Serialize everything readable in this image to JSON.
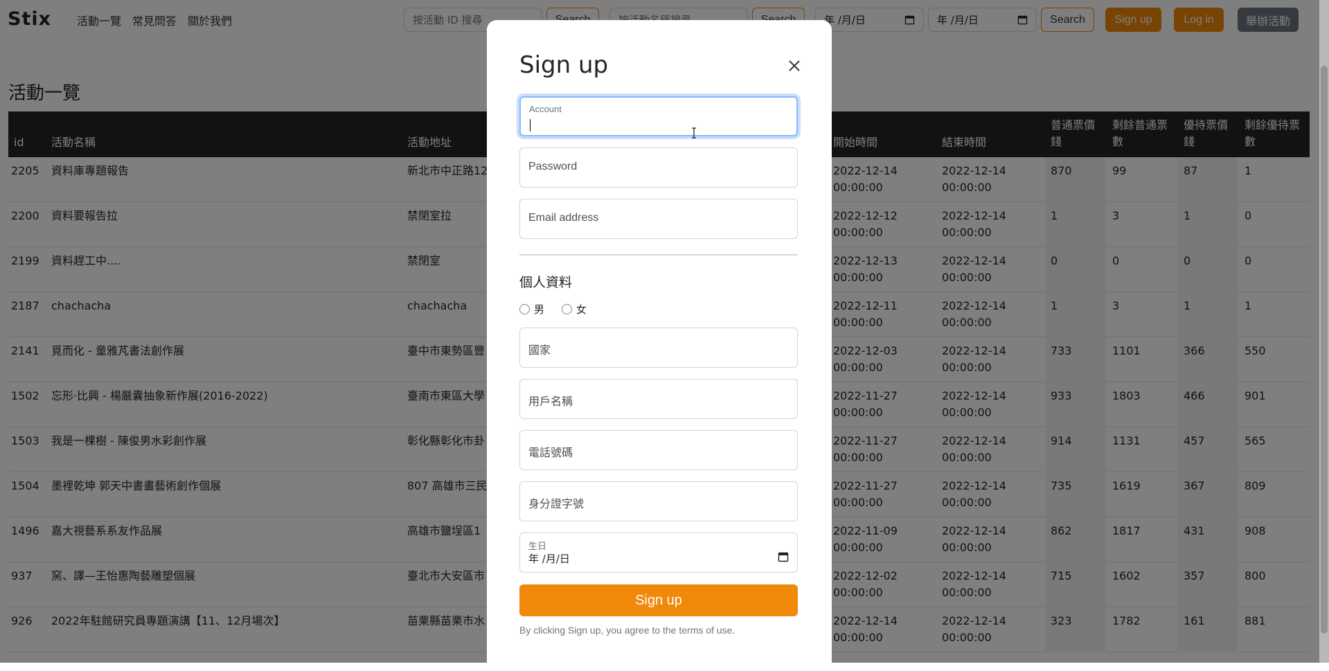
{
  "navbar": {
    "brand": "Stix",
    "links": [
      "活動一覽",
      "常見問答",
      "關於我們"
    ],
    "search_id_placeholder": "按活動 ID 搜尋",
    "search_id_button": "Search",
    "search_name_placeholder": "按活動名稱搜尋",
    "search_name_button": "Search",
    "date_start": "年 /月/日",
    "date_end": "年 /月/日",
    "date_search_button": "Search",
    "signup_button": "Sign up",
    "login_button": "Log in",
    "host_button": "舉辦活動"
  },
  "page": {
    "title": "活動一覽",
    "columns": [
      "id",
      "活動名稱",
      "活動地址",
      "開始時間",
      "結束時間",
      "普通票價錢",
      "剩餘普通票數",
      "優待票價錢",
      "剩餘優待票數"
    ],
    "rows": [
      {
        "id": "2205",
        "name": "資料庫專題報告",
        "addr": "新北市中正路12",
        "start": "2022-12-14 00:00:00",
        "end": "2022-12-14 00:00:00",
        "p1": "870",
        "r1": "99",
        "p2": "87",
        "r2": "1"
      },
      {
        "id": "2200",
        "name": "資料要報告拉",
        "addr": "禁閉室拉",
        "start": "2022-12-12 00:00:00",
        "end": "2022-12-14 00:00:00",
        "p1": "1",
        "r1": "3",
        "p2": "1",
        "r2": "0"
      },
      {
        "id": "2199",
        "name": "資料趕工中....",
        "addr": "禁閉室",
        "start": "2022-12-13 00:00:00",
        "end": "2022-12-14 00:00:00",
        "p1": "0",
        "r1": "0",
        "p2": "0",
        "r2": "0"
      },
      {
        "id": "2187",
        "name": "chachacha",
        "addr": "chachacha",
        "start": "2022-12-11 00:00:00",
        "end": "2022-12-14 00:00:00",
        "p1": "1",
        "r1": "3",
        "p2": "1",
        "r2": "1"
      },
      {
        "id": "2141",
        "name": "覓而化 - 童雅芃書法創作展",
        "addr": "臺中市東勢區豐",
        "start": "2022-12-03 00:00:00",
        "end": "2022-12-14 00:00:00",
        "p1": "733",
        "r1": "1101",
        "p2": "366",
        "r2": "550"
      },
      {
        "id": "1502",
        "name": "忘形·比興 - 楊嚴囊抽象新作展(2016-2022)",
        "addr": "臺南市東區大學",
        "start": "2022-11-27 00:00:00",
        "end": "2022-12-14 00:00:00",
        "p1": "933",
        "r1": "1803",
        "p2": "466",
        "r2": "901"
      },
      {
        "id": "1503",
        "name": "我是一棵樹 - 陳俊男水彩創作展",
        "addr": "彰化縣彰化市卦",
        "start": "2022-11-27 00:00:00",
        "end": "2022-12-14 00:00:00",
        "p1": "914",
        "r1": "1131",
        "p2": "457",
        "r2": "565"
      },
      {
        "id": "1504",
        "name": "墨裡乾坤 郭天中書畫藝術創作個展",
        "addr": "807 高雄市三民",
        "start": "2022-11-27 00:00:00",
        "end": "2022-12-14 00:00:00",
        "p1": "735",
        "r1": "1619",
        "p2": "367",
        "r2": "809"
      },
      {
        "id": "1496",
        "name": "嘉大視藝系系友作品展",
        "addr": "高雄市鹽埕區1",
        "start": "2022-11-09 00:00:00",
        "end": "2022-12-14 00:00:00",
        "p1": "862",
        "r1": "1817",
        "p2": "431",
        "r2": "908"
      },
      {
        "id": "937",
        "name": "窯、譯—王怡惠陶藝雕塑個展",
        "addr": "臺北市大安區市",
        "start": "2022-12-02 00:00:00",
        "end": "2022-12-14 00:00:00",
        "p1": "715",
        "r1": "1602",
        "p2": "357",
        "r2": "800"
      },
      {
        "id": "926",
        "name": "2022年駐館研究員專題演講【11、12月場次】",
        "addr": "苗栗縣苗栗市水",
        "start": "2022-12-14 00:00:00",
        "end": "2022-12-14 00:00:00",
        "p1": "323",
        "r1": "1782",
        "p2": "161",
        "r2": "881"
      }
    ]
  },
  "modal": {
    "title": "Sign up",
    "account_label": "Account",
    "password_placeholder": "Password",
    "email_placeholder": "Email address",
    "section_title": "個人資料",
    "gender_male": "男",
    "gender_female": "女",
    "country_placeholder": "國家",
    "username_placeholder": "用戶名稱",
    "phone_placeholder": "電話號碼",
    "id_placeholder": "身分證字號",
    "birthday_label": "生日",
    "birthday_value": "年 /月/日",
    "submit_label": "Sign up",
    "terms": "By clicking Sign up, you agree to the terms of use."
  },
  "colors": {
    "accent": "#f0880a",
    "table_header": "#212529",
    "focus_ring": "#86b7fe"
  },
  "icons": [
    "close-icon",
    "calendar-icon",
    "text-cursor-icon"
  ]
}
